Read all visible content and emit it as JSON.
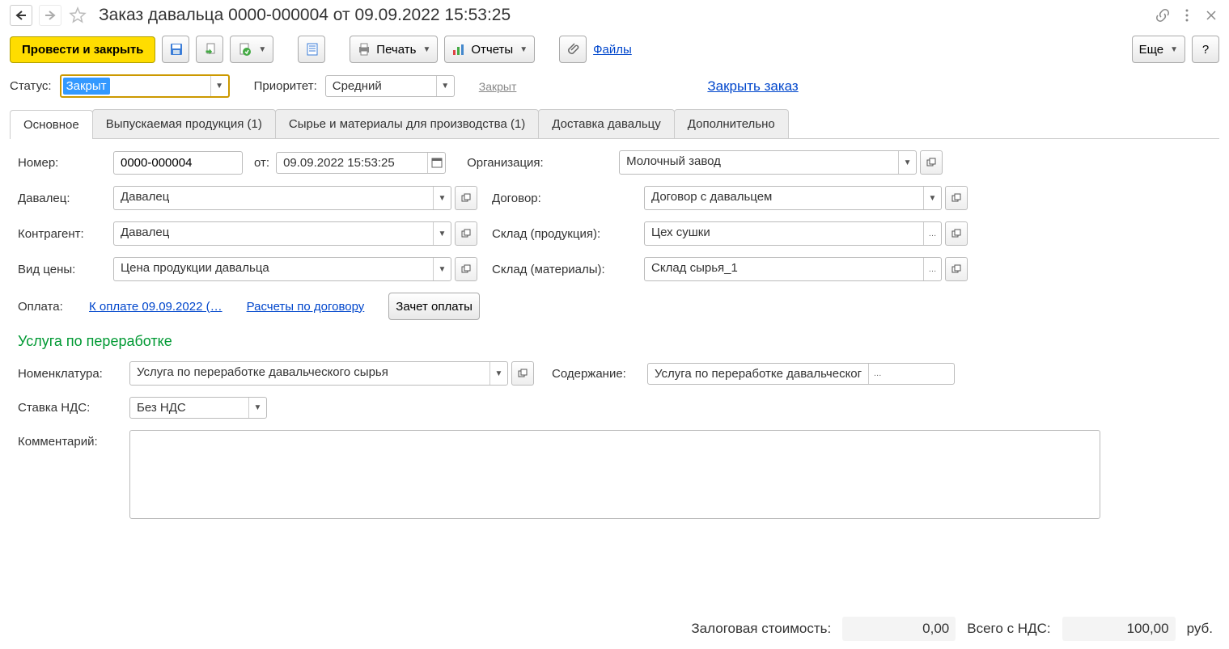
{
  "header": {
    "title": "Заказ давальца 0000-000004 от 09.09.2022 15:53:25"
  },
  "toolbar": {
    "post_close": "Провести и закрыть",
    "print": "Печать",
    "reports": "Отчеты",
    "files": "Файлы",
    "more": "Еще",
    "help": "?"
  },
  "status_row": {
    "status_label": "Статус:",
    "status_value": "Закрыт",
    "priority_label": "Приоритет:",
    "priority_value": "Средний",
    "closed_hint": "Закрыт",
    "close_order_link": "Закрыть заказ"
  },
  "tabs": [
    "Основное",
    "Выпускаемая продукция (1)",
    "Сырье и материалы для производства (1)",
    "Доставка давальцу",
    "Дополнительно"
  ],
  "form": {
    "number_label": "Номер:",
    "number_value": "0000-000004",
    "from_label": "от:",
    "date_value": "09.09.2022 15:53:25",
    "org_label": "Организация:",
    "org_value": "Молочный завод",
    "davalec_label": "Давалец:",
    "davalec_value": "Давалец",
    "contract_label": "Договор:",
    "contract_value": "Договор с давальцем",
    "counterparty_label": "Контрагент:",
    "counterparty_value": "Давалец",
    "warehouse_prod_label": "Склад (продукция):",
    "warehouse_prod_value": "Цех сушки",
    "price_type_label": "Вид цены:",
    "price_type_value": "Цена продукции давальца",
    "warehouse_mat_label": "Склад (материалы):",
    "warehouse_mat_value": "Склад сырья_1",
    "payment_label": "Оплата:",
    "payment_link1": "К оплате 09.09.2022 (…",
    "payment_link2": "Расчеты по договору",
    "offset_btn": "Зачет оплаты"
  },
  "service": {
    "section_title": "Услуга по переработке",
    "nomenclature_label": "Номенклатура:",
    "nomenclature_value": "Услуга по переработке давальческого сырья",
    "content_label": "Содержание:",
    "content_value": "Услуга по переработке давальческог",
    "vat_label": "Ставка НДС:",
    "vat_value": "Без НДС",
    "comment_label": "Комментарий:",
    "comment_value": ""
  },
  "footer": {
    "collateral_label": "Залоговая стоимость:",
    "collateral_value": "0,00",
    "total_label": "Всего с НДС:",
    "total_value": "100,00",
    "currency": "руб."
  }
}
